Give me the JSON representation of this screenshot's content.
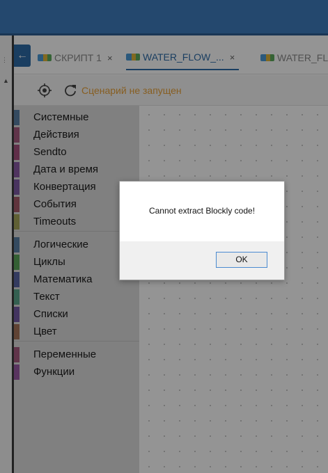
{
  "tabs": [
    {
      "label": "СКРИПТ 1",
      "close": "×",
      "active": false
    },
    {
      "label": "WATER_FLOW_...",
      "close": "×",
      "active": true
    },
    {
      "label": "WATER_FL",
      "close": "",
      "active": false
    }
  ],
  "collapse_glyph": "←",
  "toolbar": {
    "target_icon": "crosshair-icon",
    "refresh_icon": "refresh-icon",
    "status": "Сценарий не запущен"
  },
  "categories": [
    {
      "label": "Системные",
      "color": "#5b80a5"
    },
    {
      "label": "Действия",
      "color": "#a55b80"
    },
    {
      "label": "Sendto",
      "color": "#a5507f"
    },
    {
      "label": "Дата и время",
      "color": "#8a5ba5"
    },
    {
      "label": "Конвертация",
      "color": "#7e5ba5"
    },
    {
      "label": "События",
      "color": "#a55b6a"
    },
    {
      "label": "Timeouts",
      "color": "#a5a55b"
    },
    {
      "label": "Логические",
      "color": "#5b80a5"
    },
    {
      "label": "Циклы",
      "color": "#5ba55b"
    },
    {
      "label": "Математика",
      "color": "#5b67a5"
    },
    {
      "label": "Текст",
      "color": "#5ba58c"
    },
    {
      "label": "Списки",
      "color": "#745ba5"
    },
    {
      "label": "Цвет",
      "color": "#a5745b"
    },
    {
      "label": "Переменные",
      "color": "#a55b80"
    },
    {
      "label": "Функции",
      "color": "#995ba5"
    }
  ],
  "dialog": {
    "message": "Cannot extract Blockly code!",
    "ok_label": "OK"
  },
  "colors": {
    "topbar": "#3f7dbd",
    "accent": "#2e6ca8",
    "status": "#e8a23a"
  }
}
